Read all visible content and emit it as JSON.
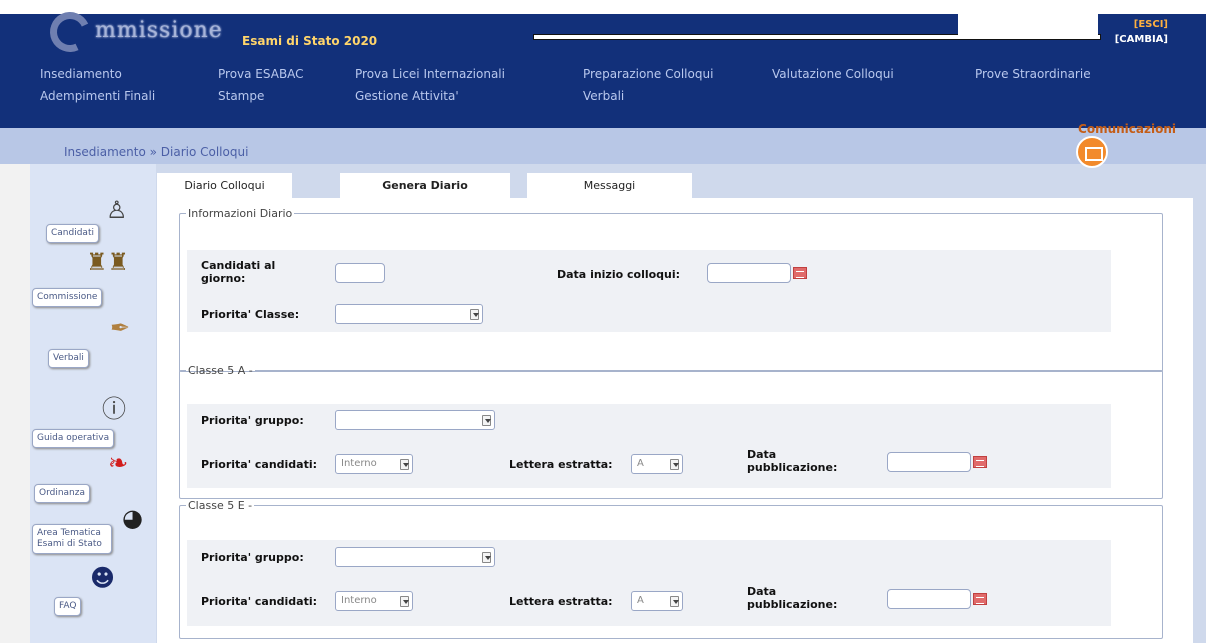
{
  "header": {
    "logo_text": "mmissione",
    "subtitle": "Esami di Stato 2020",
    "esci": "[ESCI]",
    "cambia": "[CAMBIA]",
    "communications": "Comunicazioni"
  },
  "menu": [
    {
      "label": "Insediamento"
    },
    {
      "label": "Prova ESABAC"
    },
    {
      "label": "Prova Licei Internazionali"
    },
    {
      "label": "Preparazione Colloqui"
    },
    {
      "label": "Valutazione Colloqui"
    },
    {
      "label": "Prove Straordinarie"
    },
    {
      "label": "Adempimenti Finali"
    },
    {
      "label": "Stampe"
    },
    {
      "label": "Gestione Attivita'"
    },
    {
      "label": "Verbali"
    }
  ],
  "breadcrumb": "Insediamento » Diario Colloqui",
  "sidebar": [
    {
      "label": "Candidati",
      "icon": "student-icon"
    },
    {
      "label": "Commissione",
      "icon": "group-icon"
    },
    {
      "label": "Verbali",
      "icon": "quill-icon"
    },
    {
      "label": "Guida operativa",
      "icon": "help-icon"
    },
    {
      "label": "Ordinanza",
      "icon": "pdf-icon"
    },
    {
      "label": "Area Tematica Esami di Stato",
      "icon": "globe-icon"
    },
    {
      "label": "FAQ",
      "icon": "face-icon"
    }
  ],
  "tabs": [
    {
      "label": "Diario Colloqui",
      "active": false
    },
    {
      "label": "Genera Diario",
      "active": true
    },
    {
      "label": "Messaggi",
      "active": false
    }
  ],
  "info": {
    "legend": "Informazioni Diario",
    "candidati_label": "Candidati al giorno:",
    "candidati_value": "",
    "data_label": "Data inizio colloqui:",
    "data_value": "",
    "priorita_classe_label": "Priorita' Classe:",
    "priorita_classe_value": ""
  },
  "classi": [
    {
      "legend": "Classe 5 A -",
      "gruppo_label": "Priorita' gruppo:",
      "gruppo_value": "",
      "candidati_label": "Priorita' candidati:",
      "candidati_value": "Interno",
      "lettera_label": "Lettera estratta:",
      "lettera_value": "A",
      "pub_label": "Data pubblicazione:",
      "pub_value": ""
    },
    {
      "legend": "Classe 5 E -",
      "gruppo_label": "Priorita' gruppo:",
      "gruppo_value": "",
      "candidati_label": "Priorita' candidati:",
      "candidati_value": "Interno",
      "lettera_label": "Lettera estratta:",
      "lettera_value": "A",
      "pub_label": "Data pubblicazione:",
      "pub_value": ""
    }
  ],
  "colors": {
    "header_bg": "#12307a",
    "accent": "#f28a2c",
    "page_bg": "#cfd9ec"
  }
}
